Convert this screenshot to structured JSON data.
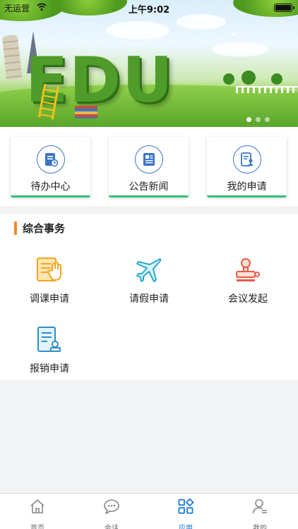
{
  "status_bar": {
    "carrier": "无运营",
    "time": "上午9:02"
  },
  "banner": {
    "headline": "EDU",
    "slides": 3,
    "active_slide": 1
  },
  "quick_cards": [
    {
      "label": "待办中心",
      "icon": "todo-center-icon"
    },
    {
      "label": "公告新闻",
      "icon": "news-icon"
    },
    {
      "label": "我的申请",
      "icon": "my-application-icon"
    }
  ],
  "section": {
    "title": "综合事务",
    "apps": [
      {
        "label": "调课申请",
        "icon": "course-adjust-icon"
      },
      {
        "label": "请假申请",
        "icon": "leave-airplane-icon"
      },
      {
        "label": "会议发起",
        "icon": "meeting-stamp-icon"
      },
      {
        "label": "报销申请",
        "icon": "reimbursement-icon"
      }
    ]
  },
  "tabbar": [
    {
      "label": "首页",
      "icon": "home-icon"
    },
    {
      "label": "会话",
      "icon": "chat-icon"
    },
    {
      "label": "应用",
      "icon": "apps-icon",
      "active": true
    },
    {
      "label": "我的",
      "icon": "profile-icon"
    }
  ],
  "colors": {
    "accent": "#1a78d6",
    "card_underline": "#34c07a",
    "section_bar": "#f0892f",
    "icon_blue": "#3a74c9"
  }
}
